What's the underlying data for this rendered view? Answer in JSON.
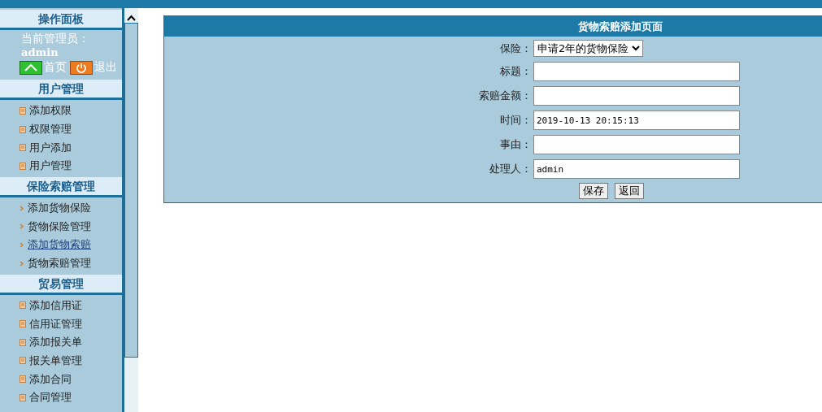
{
  "sidebar": {
    "panel_title": "操作面板",
    "admin_label": "当前管理员：",
    "admin_name": "admin",
    "home_link": "首页",
    "logout_link": "退出",
    "sections": [
      {
        "title": "用户管理",
        "kind": "doc",
        "items": [
          {
            "label": "添加权限",
            "selected": false
          },
          {
            "label": "权限管理",
            "selected": false
          },
          {
            "label": "用户添加",
            "selected": false
          },
          {
            "label": "用户管理",
            "selected": false
          }
        ]
      },
      {
        "title": "保险索赔管理",
        "kind": "chevron",
        "items": [
          {
            "label": "添加货物保险",
            "selected": false
          },
          {
            "label": "货物保险管理",
            "selected": false
          },
          {
            "label": "添加货物索赔",
            "selected": true
          },
          {
            "label": "货物索赔管理",
            "selected": false
          }
        ]
      },
      {
        "title": "贸易管理",
        "kind": "doc",
        "items": [
          {
            "label": "添加信用证",
            "selected": false
          },
          {
            "label": "信用证管理",
            "selected": false
          },
          {
            "label": "添加报关单",
            "selected": false
          },
          {
            "label": "报关单管理",
            "selected": false
          },
          {
            "label": "添加合同",
            "selected": false
          },
          {
            "label": "合同管理",
            "selected": false
          }
        ]
      }
    ]
  },
  "form": {
    "title": "货物索赔添加页面",
    "fields": [
      {
        "kind": "select",
        "label": "保险：",
        "value": "申请2年的货物保险"
      },
      {
        "kind": "text",
        "label": "标题："
      },
      {
        "kind": "text",
        "label": "索赔金额："
      },
      {
        "kind": "text",
        "label": "时间：",
        "value": "2019-10-13 20:15:13"
      },
      {
        "kind": "text",
        "label": "事由："
      },
      {
        "kind": "text",
        "label": "处理人：",
        "value": "admin"
      }
    ],
    "buttons": [
      "保存",
      "返回"
    ]
  }
}
